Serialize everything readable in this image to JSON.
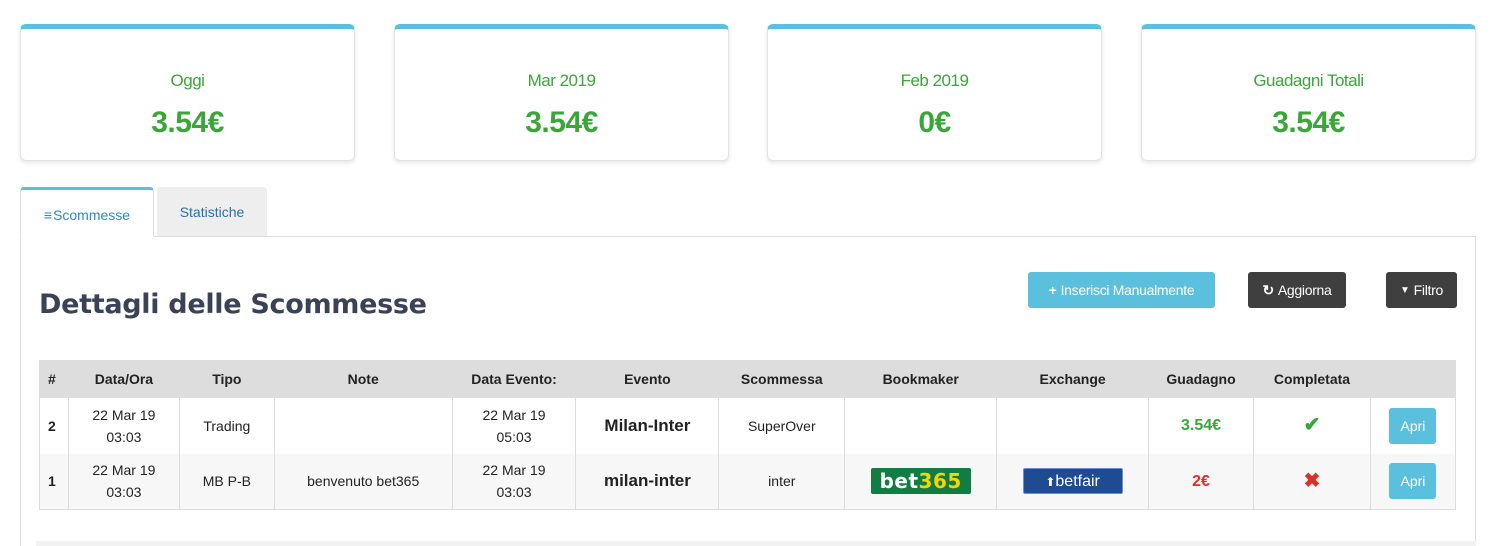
{
  "cards": [
    {
      "label": "Oggi",
      "value": "3.54€"
    },
    {
      "label": "Mar 2019",
      "value": "3.54€"
    },
    {
      "label": "Feb 2019",
      "value": "0€"
    },
    {
      "label": "Guadagni Totali",
      "value": "3.54€"
    }
  ],
  "tabs": {
    "active": {
      "icon": "≡",
      "label": "Scommesse"
    },
    "inactive": {
      "label": "Statistiche"
    }
  },
  "panel": {
    "title": "Dettagli delle Scommesse",
    "buttons": {
      "insert": {
        "icon": "+",
        "label": "Inserisci Manualmente"
      },
      "refresh": {
        "icon": "↻",
        "label": "Aggiorna"
      },
      "filter": {
        "icon": "▼",
        "label": "Filtro"
      }
    }
  },
  "table": {
    "headers": [
      "#",
      "Data/Ora",
      "Tipo",
      "Note",
      "Data Evento:",
      "Evento",
      "Scommessa",
      "Bookmaker",
      "Exchange",
      "Guadagno",
      "Completata",
      ""
    ],
    "rows": [
      {
        "id": "2",
        "date_line1": "22 Mar 19",
        "date_line2": "03:03",
        "type": "Trading",
        "note": "",
        "event_date_line1": "22 Mar 19",
        "event_date_line2": "05:03",
        "event": "Milan-Inter",
        "bet": "SuperOver",
        "bookmaker": "",
        "exchange": "",
        "gain": "3.54€",
        "completed": "✔",
        "action": "Apri"
      },
      {
        "id": "1",
        "date_line1": "22 Mar 19",
        "date_line2": "03:03",
        "type": "MB P-B",
        "note": "benvenuto bet365",
        "event_date_line1": "22 Mar 19",
        "event_date_line2": "03:03",
        "event": "milan-inter",
        "bet": "inter",
        "bookmaker_logo": {
          "main": "bet",
          "accent": "365"
        },
        "exchange_logo": "betfair",
        "gain": "2€",
        "completed": "✖",
        "action": "Apri"
      }
    ]
  },
  "colors": {
    "accent": "#5bc0de",
    "positive": "#3aa63a",
    "negative": "#d9302b",
    "dark_button": "#3f3f3f"
  }
}
